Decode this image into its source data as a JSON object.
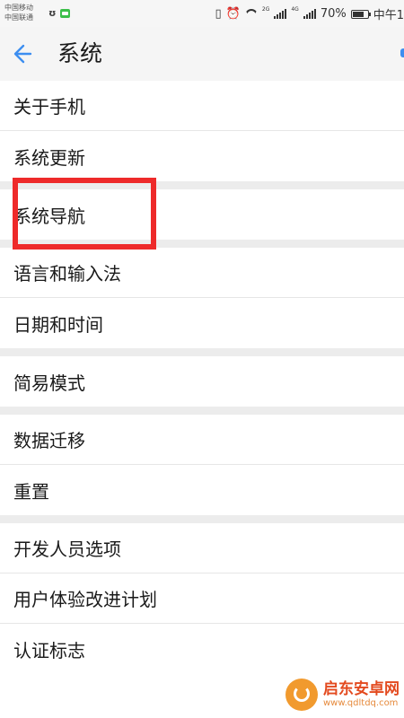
{
  "status_bar": {
    "carrier_1": "中国移动",
    "carrier_2": "中国联通",
    "battery": "70%",
    "time": "中午1",
    "net_label_1": "2G",
    "net_label_2": "4G"
  },
  "header": {
    "title": "系统"
  },
  "groups": [
    {
      "items": [
        "关于手机",
        "系统更新"
      ]
    },
    {
      "items": [
        "系统导航"
      ]
    },
    {
      "items": [
        "语言和输入法",
        "日期和时间"
      ]
    },
    {
      "items": [
        "简易模式"
      ]
    },
    {
      "items": [
        "数据迁移",
        "重置"
      ]
    },
    {
      "items": [
        "开发人员选项",
        "用户体验改进计划",
        "认证标志"
      ]
    }
  ],
  "watermark": {
    "title": "启东安卓网",
    "url": "www.qdltdq.com"
  },
  "colors": {
    "accent": "#3d8ef0",
    "highlight": "#ee2a2a",
    "watermark": "#e34a1f"
  }
}
